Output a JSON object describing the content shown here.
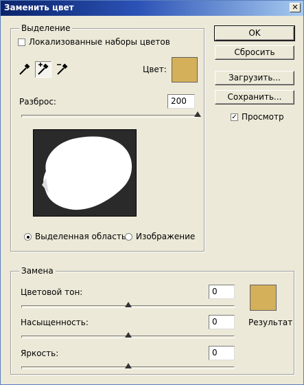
{
  "window": {
    "title": "Заменить цвет",
    "close_glyph": "✕"
  },
  "selection": {
    "legend": "Выделение",
    "localized_label": "Локализованные наборы цветов",
    "localized_checked": false,
    "color_label": "Цвет:",
    "color": "#d4b05b",
    "fuzziness_label": "Разброс:",
    "fuzziness_value": "200",
    "fuzziness_max": 200,
    "fuzziness_level": 1.0,
    "tools": [
      "eyedropper-icon",
      "eyedropper-plus-icon",
      "eyedropper-minus-icon"
    ],
    "active_tool": 1,
    "mode_selection_label": "Выделенная область",
    "mode_image_label": "Изображение",
    "mode_selected": "selection"
  },
  "buttons": {
    "ok": "OK",
    "reset": "Сбросить",
    "load": "Загрузить...",
    "save": "Сохранить..."
  },
  "preview_option": {
    "label": "Просмотр",
    "checked": true,
    "check_glyph": "✓"
  },
  "replacement": {
    "legend": "Замена",
    "hue_label": "Цветовой тон:",
    "hue_value": "0",
    "saturation_label": "Насыщенность:",
    "saturation_value": "0",
    "lightness_label": "Яркость:",
    "lightness_value": "0",
    "slider_level": 0.5,
    "result_label": "Результат",
    "result_color": "#d4b05b"
  }
}
